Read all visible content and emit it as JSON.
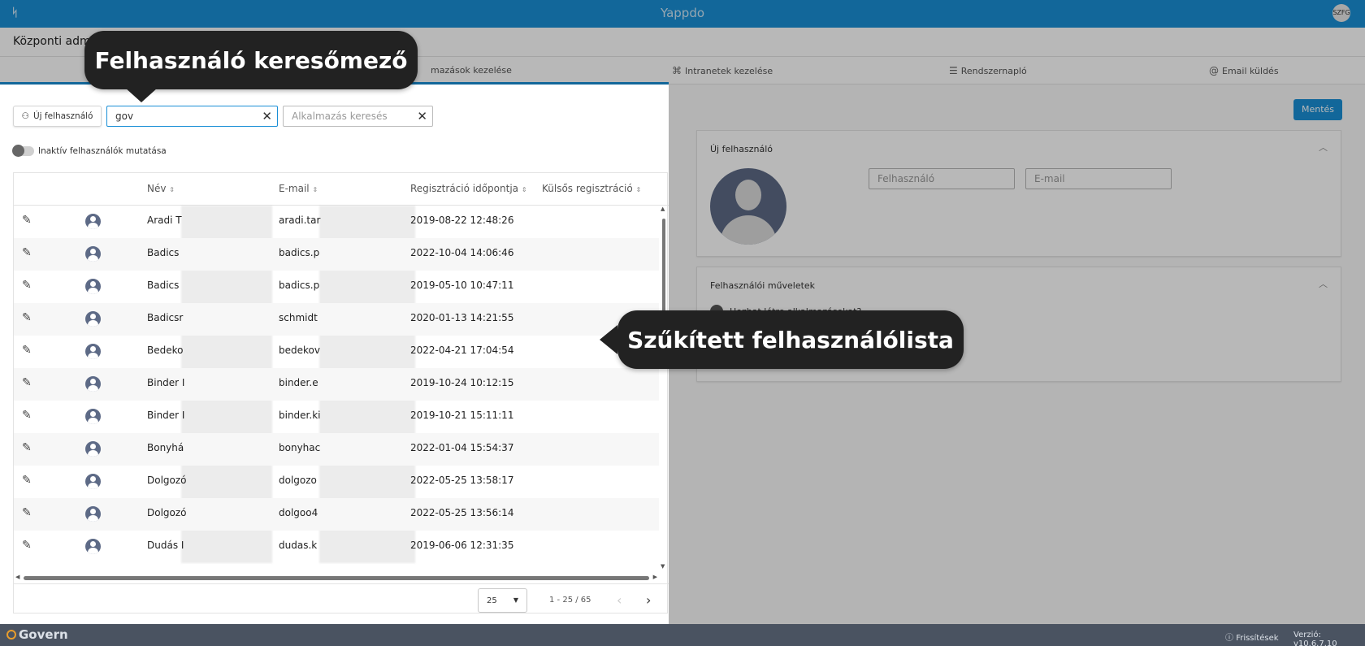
{
  "topbar": {
    "app_title": "Yappdo",
    "user_initials": "SZFG"
  },
  "subheader": {
    "page_title": "Központi admi"
  },
  "nav": {
    "tabs": [
      {
        "label": "mazások kezelése",
        "icon": "apps-icon"
      },
      {
        "label": "Intranetek kezelése",
        "icon": "network-icon"
      },
      {
        "label": "Rendszernapló",
        "icon": "list-icon"
      },
      {
        "label": "Email küldés",
        "icon": "at-icon"
      }
    ]
  },
  "left": {
    "new_user_label": "Új felhasználó",
    "user_search": {
      "value": "gov",
      "placeholder": "Felhasználó keresés"
    },
    "app_search": {
      "value": "",
      "placeholder": "Alkalmazás keresés"
    },
    "show_inactive_label": "Inaktív felhasználók mutatása"
  },
  "table": {
    "columns": [
      "Név",
      "E-mail",
      "Regisztráció időpontja",
      "Külsős regisztráció"
    ],
    "rows": [
      {
        "name": "Aradi T",
        "email": "aradi.tar",
        "registered": "2019-08-22 12:48:26"
      },
      {
        "name": "Badics",
        "email": "badics.p",
        "registered": "2022-10-04 14:06:46"
      },
      {
        "name": "Badics",
        "email": "badics.p",
        "registered": "2019-05-10 10:47:11"
      },
      {
        "name": "Badicsr",
        "email": "schmidt",
        "registered": "2020-01-13 14:21:55"
      },
      {
        "name": "Bedeko",
        "email": "bedekov",
        "registered": "2022-04-21 17:04:54"
      },
      {
        "name": "Binder I",
        "email": "binder.e",
        "registered": "2019-10-24 10:12:15"
      },
      {
        "name": "Binder I",
        "email": "binder.ki",
        "registered": "2019-10-21 15:11:11"
      },
      {
        "name": "Bonyhá",
        "email": "bonyhac",
        "registered": "2022-01-04 15:54:37"
      },
      {
        "name": "Dolgozó",
        "email": "dolgozo",
        "registered": "2022-05-25 13:58:17"
      },
      {
        "name": "Dolgozó",
        "email": "dolgoo4",
        "registered": "2022-05-25 13:56:14"
      },
      {
        "name": "Dudás I",
        "email": "dudas.k",
        "registered": "2019-06-06 12:31:35"
      }
    ]
  },
  "pager": {
    "page_size": "25",
    "range": "1 - 25 / 65"
  },
  "right": {
    "save_label": "Mentés",
    "new_user_card_title": "Új felhasználó",
    "user_field_placeholder": "Felhasználó",
    "email_field_placeholder": "E-mail",
    "ops_card_title": "Felhasználói műveletek",
    "ops_item": "Hozhat létre alkalmazásokat?"
  },
  "callouts": {
    "search": "Felhasználó keresőmező",
    "list": "Szűkített felhasználólista"
  },
  "footer": {
    "brand": "Govern",
    "updates": "Frissítések",
    "version": "Verzió: v10.6.7.10"
  }
}
